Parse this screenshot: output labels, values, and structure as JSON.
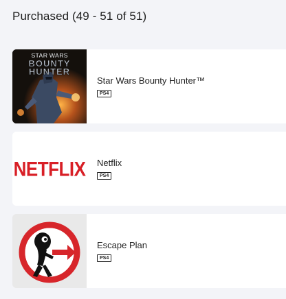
{
  "section": {
    "title": "Purchased (49 - 51 of 51)"
  },
  "items": [
    {
      "title": "Star Wars Bounty Hunter™",
      "platform": "PS4",
      "thumbnail_icon": "star-wars-bounty-hunter-cover",
      "thumbnail_logo": [
        "STAR WARS",
        "BOUNTY",
        "HUNTER"
      ]
    },
    {
      "title": "Netflix",
      "platform": "PS4",
      "thumbnail_icon": "netflix-logo",
      "thumbnail_logo": "NETFLIX"
    },
    {
      "title": "Escape Plan",
      "platform": "PS4",
      "thumbnail_icon": "escape-plan-cover"
    }
  ],
  "colors": {
    "background": "#f3f4f8",
    "card": "#ffffff",
    "netflix_red": "#d81f26",
    "escape_red": "#d7262b"
  }
}
